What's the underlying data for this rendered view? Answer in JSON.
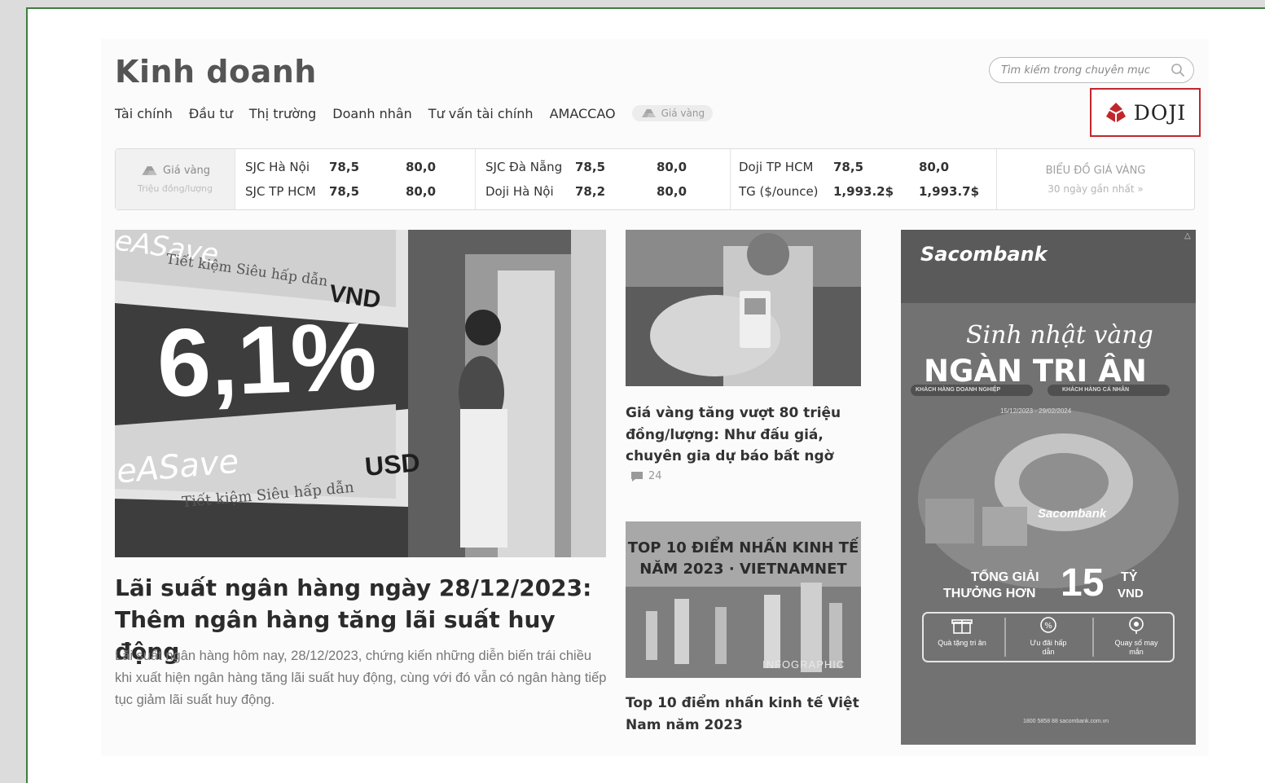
{
  "header": {
    "title": "Kinh doanh",
    "nav": [
      "Tài chính",
      "Đầu tư",
      "Thị trường",
      "Doanh nhân",
      "Tư vấn tài chính",
      "AMACCAO"
    ],
    "gold_pill": "Giá vàng",
    "search_placeholder": "Tìm kiếm trong chuyên mục",
    "sponsor_logo_text": "DOJI"
  },
  "ticker": {
    "label": "Giá vàng",
    "unit": "Triệu đồng/lượng",
    "rows": [
      {
        "name": "SJC Hà Nội",
        "buy": "78,5",
        "sell": "80,0"
      },
      {
        "name": "SJC TP HCM",
        "buy": "78,5",
        "sell": "80,0"
      },
      {
        "name": "SJC Đà Nẵng",
        "buy": "78,5",
        "sell": "80,0"
      },
      {
        "name": "Doji Hà Nội",
        "buy": "78,2",
        "sell": "80,0"
      },
      {
        "name": "Doji TP HCM",
        "buy": "78,5",
        "sell": "80,0"
      },
      {
        "name": "TG ($/ounce)",
        "buy": "1,993.2$",
        "sell": "1,993.7$"
      }
    ],
    "chart_link_title": "BIỂU ĐỒ GIÁ VÀNG",
    "chart_link_sub": "30 ngày gần nhất »"
  },
  "hero": {
    "image_text": {
      "brand1": "eASave",
      "line1": "Tiết kiệm Siêu hấp dẫn",
      "currency1": "VND",
      "rate": "6,1%",
      "brand2": "eASave",
      "line2": "Tiết kiệm Siêu hấp dẫn",
      "currency2": "USD"
    },
    "title": "Lãi suất ngân hàng ngày 28/12/2023: Thêm ngân hàng tăng lãi suất huy động",
    "sapo": "Lãi suất ngân hàng hôm nay, 28/12/2023, chứng kiến những diễn biến trái chiều khi xuất hiện ngân hàng tăng lãi suất huy động, cùng với đó vẫn có ngân hàng tiếp tục giảm lãi suất huy động."
  },
  "cards": [
    {
      "title": "Giá vàng tăng vượt 80 triệu đồng/lượng: Như đấu giá, chuyên gia dự báo bất ngờ",
      "comments": "24"
    },
    {
      "title": "Top 10 điểm nhấn kinh tế Việt Nam năm 2023",
      "image_title": "TOP 10 ĐIỂM NHẤN KINH TẾ NĂM 2023 · VIETNAMNET",
      "image_tag": "INFOGRAPHIC"
    }
  ],
  "ad": {
    "brand": "Sacombank",
    "script": "Sinh nhật vàng",
    "headline": "NGÀN TRI ÂN",
    "tag1": "KHÁCH HÀNG DOANH NGHIỆP",
    "tag2": "KHÁCH HÀNG CÁ NHÂN",
    "dates": "15/12/2023 - 29/02/2024",
    "brand_small": "Sacombank",
    "prize_line1": "TỔNG GIẢI",
    "prize_line2": "THƯỞNG HƠN",
    "prize_amount": "15",
    "prize_unit1": "TỶ",
    "prize_unit2": "VND",
    "perks": [
      "Quà tặng tri ân",
      "Ưu đãi hấp dẫn",
      "Quay số may mắn"
    ],
    "contact": "1800 5858 88   sacombank.com.vn",
    "adchoice": "△"
  },
  "colors": {
    "doji_red": "#c0272d",
    "frame_green": "#3f7f3f"
  }
}
